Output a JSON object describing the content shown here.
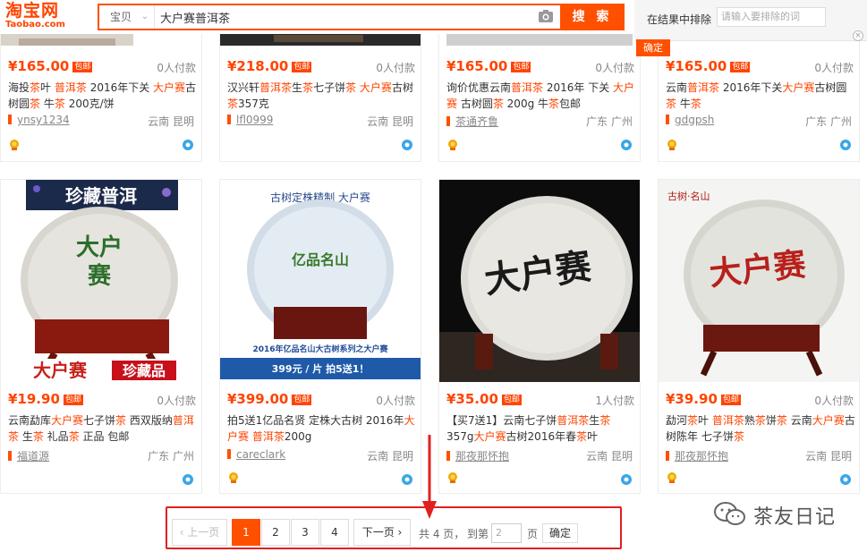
{
  "header": {
    "logo_cn": "淘宝网",
    "logo_en": "Taobao.com",
    "search_scope": "宝贝",
    "search_query": "大户赛普洱茶",
    "search_button": "搜 索",
    "exclude_label": "在结果中排除",
    "exclude_placeholder": "请输入要排除的词",
    "exclude_confirm": "确定"
  },
  "products": [
    {
      "price": "¥165.00",
      "ship": "包邮",
      "deals": "0人付款",
      "title": [
        [
          "海投",
          false
        ],
        [
          "茶",
          true
        ],
        [
          "叶 ",
          false
        ],
        [
          "普洱茶",
          true
        ],
        [
          " 2016年下关 ",
          false
        ],
        [
          "大户赛",
          true
        ],
        [
          "古树圆",
          false
        ],
        [
          "茶",
          true
        ],
        [
          " 牛",
          false
        ],
        [
          "茶",
          true
        ],
        [
          " 200克/饼",
          false
        ]
      ],
      "shop": "ynsy1234",
      "loc": "云南 昆明"
    },
    {
      "price": "¥218.00",
      "ship": "包邮",
      "deals": "0人付款",
      "title": [
        [
          "汉兴轩",
          false
        ],
        [
          "普洱茶",
          true
        ],
        [
          "生",
          false
        ],
        [
          "茶",
          true
        ],
        [
          "七子饼",
          false
        ],
        [
          "茶",
          true
        ],
        [
          " ",
          false
        ],
        [
          "大户赛",
          true
        ],
        [
          "古树",
          false
        ],
        [
          "茶",
          true
        ],
        [
          "357克",
          false
        ]
      ],
      "shop": "lfl0999",
      "loc": "云南 昆明"
    },
    {
      "price": "¥165.00",
      "ship": "包邮",
      "deals": "0人付款",
      "title": [
        [
          "询价优惠云南",
          false
        ],
        [
          "普洱茶",
          true
        ],
        [
          " 2016年 下关 ",
          false
        ],
        [
          "大户赛",
          true
        ],
        [
          " 古树圆",
          false
        ],
        [
          "茶",
          true
        ],
        [
          " 200g ",
          false
        ],
        [
          "牛",
          false
        ],
        [
          "茶",
          true
        ],
        [
          "包邮",
          false
        ]
      ],
      "shop": "茶通齐鲁",
      "loc": "广东 广州"
    },
    {
      "price": "¥165.00",
      "ship": "包邮",
      "deals": "0人付款",
      "title": [
        [
          "云南",
          false
        ],
        [
          "普洱茶",
          true
        ],
        [
          " 2016年下关",
          false
        ],
        [
          "大户赛",
          true
        ],
        [
          "古树圆",
          false
        ],
        [
          "茶",
          true
        ],
        [
          " 牛",
          false
        ],
        [
          "茶",
          true
        ]
      ],
      "shop": "gdgpsh",
      "loc": "广东 广州"
    },
    {
      "price": "¥19.90",
      "ship": "包邮",
      "deals": "0人付款",
      "title": [
        [
          "云南勐库",
          false
        ],
        [
          "大户赛",
          true
        ],
        [
          "七子饼",
          false
        ],
        [
          "茶",
          true
        ],
        [
          " 西双版纳",
          false
        ],
        [
          "普洱",
          true
        ],
        [
          "茶",
          true
        ],
        [
          " 生",
          false
        ],
        [
          "茶",
          true
        ],
        [
          " 礼品",
          false
        ],
        [
          "茶",
          true
        ],
        [
          " 正品 包邮",
          false
        ]
      ],
      "shop": "福道源",
      "loc": "广东 广州",
      "img_top": "珍藏普洱",
      "img_bottom_left": "大户赛",
      "img_bottom_right": "珍藏品"
    },
    {
      "price": "¥399.00",
      "ship": "包邮",
      "deals": "0人付款",
      "title": [
        [
          "拍5送1亿品名贤 定株大古树 2016年",
          false
        ],
        [
          "大户赛",
          true
        ],
        [
          " ",
          false
        ],
        [
          "普洱茶",
          true
        ],
        [
          "200g",
          false
        ]
      ],
      "shop": "careclark",
      "loc": "云南 昆明",
      "img_top": "古树定株精制   大户赛",
      "img_name": "亿品名山",
      "img_caption": "2016年亿品名山大古树系列之大户赛",
      "img_offer": "399元 / 片   拍5送1！"
    },
    {
      "price": "¥35.00",
      "ship": "包邮",
      "deals": "1人付款",
      "title": [
        [
          "【买7送1】云南七子饼",
          false
        ],
        [
          "普洱茶",
          true
        ],
        [
          "生",
          false
        ],
        [
          "茶",
          true
        ],
        [
          "357g",
          false
        ],
        [
          "大户赛",
          true
        ],
        [
          "古树2016年春",
          false
        ],
        [
          "茶",
          true
        ],
        [
          "叶",
          false
        ]
      ],
      "shop": "那夜那怀抱",
      "loc": "云南 昆明",
      "img_name": "大户赛"
    },
    {
      "price": "¥39.90",
      "ship": "包邮",
      "deals": "0人付款",
      "title": [
        [
          "勐河",
          false
        ],
        [
          "茶",
          true
        ],
        [
          "叶 ",
          false
        ],
        [
          "普洱茶",
          true
        ],
        [
          "熟",
          false
        ],
        [
          "茶",
          true
        ],
        [
          "饼",
          false
        ],
        [
          "茶",
          true
        ],
        [
          " 云南",
          false
        ],
        [
          "大户赛",
          true
        ],
        [
          "古树陈年 七子饼",
          false
        ],
        [
          "茶",
          true
        ]
      ],
      "shop": "那夜那怀抱",
      "loc": "云南 昆明",
      "img_top": "古树·名山",
      "img_name": "大户赛"
    }
  ],
  "pagination": {
    "prev": "‹ 上一页",
    "pages": [
      "1",
      "2",
      "3",
      "4"
    ],
    "current": "1",
    "next": "下一页 ›",
    "total": "共 4 页，",
    "goto_label": "到第",
    "goto_value": "2",
    "page_unit": "页",
    "confirm": "确定"
  },
  "watermark": "茶友日记",
  "colors": {
    "accent": "#ff5000",
    "price": "#ff4400",
    "annotation": "#e02020"
  }
}
